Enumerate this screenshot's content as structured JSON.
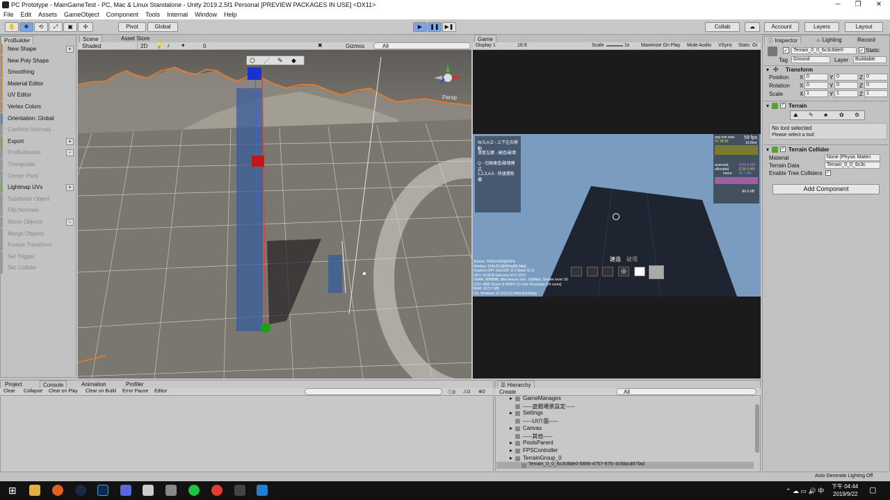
{
  "window": {
    "title": "PC Prototype - MainGameTest - PC, Mac & Linux Standalone - Unity 2019.2.5f1 Personal [PREVIEW PACKAGES IN USE] <DX11>"
  },
  "menu": [
    "File",
    "Edit",
    "Assets",
    "GameObject",
    "Component",
    "Tools",
    "Internal",
    "Window",
    "Help"
  ],
  "toolbar": {
    "pivot": "Pivot",
    "global": "Global",
    "collab": "Collab",
    "account": "Account",
    "layers": "Layers",
    "layout": "Layout"
  },
  "probuilder": {
    "tab": "ProBuilder",
    "items": [
      {
        "label": "New Shape",
        "plus": true,
        "color": "#d08a3a",
        "enabled": true
      },
      {
        "label": "New Poly Shape",
        "color": "#d08a3a",
        "enabled": true
      },
      {
        "label": "Smoothing",
        "color": "#d08a3a",
        "enabled": true
      },
      {
        "label": "Material Editor",
        "color": "#d08a3a",
        "enabled": true
      },
      {
        "label": "UV Editor",
        "color": "#d08a3a",
        "enabled": true
      },
      {
        "label": "Vertex Colors",
        "color": "#d08a3a",
        "enabled": true
      },
      {
        "label": "Orientation: Global",
        "color": "#4a8ad0",
        "enabled": true
      },
      {
        "label": "Conform Normals",
        "color": "#999999",
        "enabled": false
      },
      {
        "label": "Export",
        "plus": true,
        "color": "#7ab04a",
        "enabled": true
      },
      {
        "label": "ProBuilderize",
        "plus": true,
        "color": "#999999",
        "enabled": false
      },
      {
        "label": "Triangulate",
        "color": "#999999",
        "enabled": false
      },
      {
        "label": "Center Pivot",
        "color": "#999999",
        "enabled": false
      },
      {
        "label": "Lightmap UVs",
        "plus": true,
        "color": "#7ab04a",
        "enabled": true
      },
      {
        "label": "Subdivide Object",
        "color": "#999999",
        "enabled": false
      },
      {
        "label": "Flip Normals",
        "color": "#999999",
        "enabled": false
      },
      {
        "label": "Mirror Objects",
        "plus": true,
        "color": "#999999",
        "enabled": false
      },
      {
        "label": "Merge Objects",
        "color": "#999999",
        "enabled": false
      },
      {
        "label": "Freeze Transform",
        "color": "#999999",
        "enabled": false
      },
      {
        "label": "Set Trigger",
        "color": "#999999",
        "enabled": false
      },
      {
        "label": "Set Collider",
        "color": "#999999",
        "enabled": false
      }
    ]
  },
  "scene": {
    "tab1": "Scene",
    "tab2": "Asset Store",
    "shading": "Shaded",
    "mode2d": "2D",
    "gizmos": "Gizmos",
    "search": "All",
    "persp": "Persp",
    "lights": "0"
  },
  "game": {
    "tab": "Game",
    "display": "Display 1",
    "aspect": "16:9",
    "scale_label": "Scale",
    "scale_value": "1x",
    "maximize": "Maximize On Play",
    "mute": "Mute Audio",
    "vsync": "VSync",
    "stats": "Stats",
    "gizmos": "Gi",
    "help": [
      "W,S,A,D - 上下左右移動",
      "滑鼠左鍵 - 建造/破壞",
      "Q - 切換建造/破壞模式",
      "1,2,3,4,5 - 快速選取欄"
    ],
    "fps": {
      "avg": "avg min max",
      "vals": "57  38  60",
      "fps": "59 fps",
      "ms": "16.8ms",
      "reserved_label": "reserved",
      "reserved": "1536.0 MB",
      "allocated_label": "allocated",
      "allocated": "1136.0 MB",
      "mono_label": "mono",
      "mono": "30.7 MB",
      "db": "-80.0 dB"
    },
    "sysinfo": [
      "Screen: 1920x1080@60Hz",
      "Window: 624x351@60Hz[96.0dpi]",
      "Graphics API: Direct3D 11.0 [level 11.1]",
      "GPU: NVIDIA GeForce GTX 1070",
      "VRAM: 8088MB. Max texture size: 16384px. Shader level: 50",
      "CPU: AMD Ryzen 9 3900X 12-Core Processor [24 cores]",
      "RAM: 32717 MB",
      "OS: Windows 10  (10.0.0) 64bit [Desktop]"
    ],
    "mode_build": "建造",
    "mode_destroy": "破壞"
  },
  "inspector": {
    "tab": "Inspector",
    "tab2": "Lighting",
    "tab3": "Record",
    "name": "Terrain_0_0_6c3c8de0-",
    "static": "Static",
    "tag_label": "Tag",
    "tag": "Ground",
    "layer_label": "Layer",
    "layer": "Buildable",
    "transform": "Transform",
    "rows": [
      {
        "label": "Position",
        "x": "0",
        "y": "0",
        "z": "0"
      },
      {
        "label": "Rotation",
        "x": "0",
        "y": "0",
        "z": "0"
      },
      {
        "label": "Scale",
        "x": "1",
        "y": "1",
        "z": "1"
      }
    ],
    "terrain": "Terrain",
    "no_tool": "No tool selected",
    "select_tool": "Please select a tool",
    "collider": "Terrain Collider",
    "material_label": "Material",
    "material": "None (Physic Materi",
    "data_label": "Terrain Data",
    "data": "Terrain_0_0_6c3c",
    "trees": "Enable Tree Colliders",
    "add": "Add Component"
  },
  "console": {
    "tabs": [
      "Project",
      "Console",
      "Animation",
      "Profiler"
    ],
    "buttons": [
      "Clear",
      "Collapse",
      "Clear on Play",
      "Clear on Build",
      "Error Pause",
      "Editor"
    ],
    "counts": [
      "0",
      "0",
      "0"
    ]
  },
  "hierarchy": {
    "tab": "Hierarchy",
    "create": "Create",
    "search": "All",
    "items": [
      {
        "label": "GameManages",
        "arrow": true
      },
      {
        "label": "-----遊戲場景設定-----",
        "arrow": false
      },
      {
        "label": "Settings",
        "arrow": true
      },
      {
        "label": "-----UI介面-----",
        "arrow": false
      },
      {
        "label": "Canvas",
        "arrow": true
      },
      {
        "label": "-----其他-----",
        "arrow": false
      },
      {
        "label": "PoolsParent",
        "arrow": true
      },
      {
        "label": "FPSController",
        "arrow": true
      },
      {
        "label": "TerrainGroup_0",
        "arrow": true
      },
      {
        "label": "Terrain_0_0_6c3c8de0-5896-4757-97fc-3cfdacd87fad",
        "arrow": false,
        "selected": true
      }
    ]
  },
  "status": {
    "lighting": "Auto Generate Lighting Off"
  },
  "taskbar": {
    "time": "下午 04:44",
    "date": "2019/9/22"
  }
}
